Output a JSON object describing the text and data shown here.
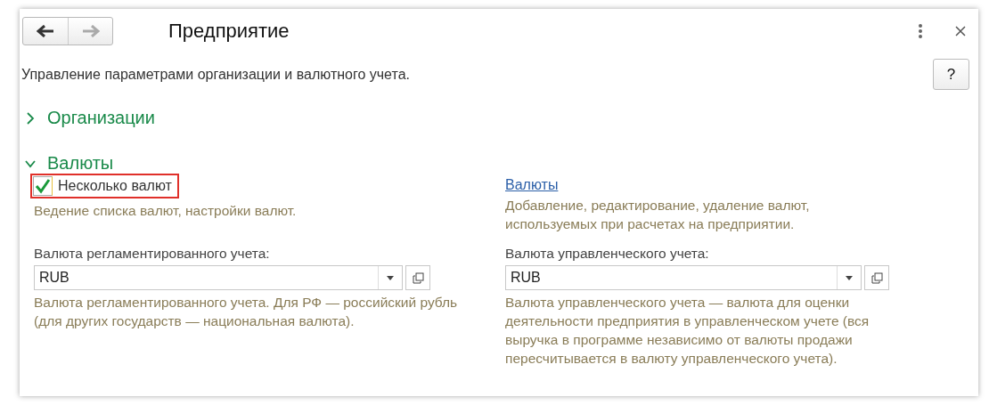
{
  "window": {
    "title": "Предприятие",
    "description": "Управление параметрами организации и валютного учета.",
    "help_button": "?"
  },
  "sections": [
    {
      "title": "Организации",
      "expanded": false
    },
    {
      "title": "Валюты",
      "expanded": true
    }
  ],
  "multi_currency": {
    "label": "Несколько валют",
    "checked": true,
    "highlighted": true,
    "hint": "Ведение списка валют, настройки валют."
  },
  "currencies_link": {
    "label": "Валюты",
    "hint": "Добавление, редактирование, удаление валют, используемых при расчетах на предприятии."
  },
  "fields": [
    {
      "label": "Валюта регламентированного учета:",
      "value": "RUB",
      "hint": "Валюта регламентированного учета. Для РФ — российский рубль (для других государств — национальная валюта)."
    },
    {
      "label": "Валюта управленческого учета:",
      "value": "RUB",
      "hint": "Валюта управленческого учета — валюта для оценки деятельности предприятия в управленческом учете (вся выручка в программе независимо от валюты продажи пересчитывается в валюту управленческого учета)."
    }
  ]
}
